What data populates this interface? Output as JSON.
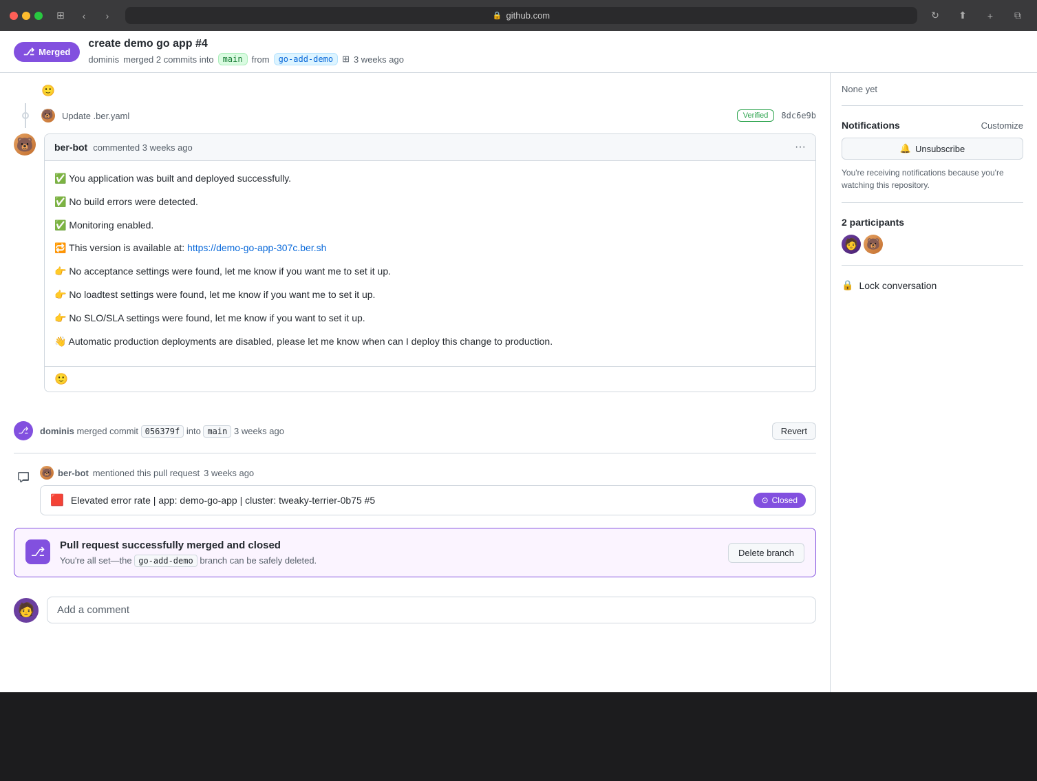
{
  "browser": {
    "url": "github.com",
    "lock": "🔒"
  },
  "header": {
    "merged_badge": "Merged",
    "merged_icon": "⎇",
    "pr_title": "create demo go app #4",
    "pr_meta_user": "dominis",
    "pr_meta_action": "merged 2 commits into",
    "pr_meta_branch_target": "main",
    "pr_meta_from": "from",
    "pr_meta_branch_source": "go-add-demo",
    "pr_meta_time": "3 weeks ago"
  },
  "commit": {
    "text": "Update .ber.yaml",
    "verified": "Verified",
    "hash": "8dc6e9b"
  },
  "comment": {
    "author": "ber-bot",
    "action": "commented",
    "time": "3 weeks ago",
    "body_lines": [
      "✅ You application was built and deployed successfully.",
      "✅ No build errors were detected.",
      "✅ Monitoring enabled."
    ],
    "link_prefix": "🔁 This version is available at: ",
    "link_text": "https://demo-go-app-307c.ber.sh",
    "link_url": "https://demo-go-app-307c.ber.sh",
    "notice_lines": [
      "👉 No acceptance settings were found, let me know if you want me to set it up.",
      "👉 No loadtest settings were found, let me know if you want me to set it up.",
      "👉 No SLO/SLA settings were found, let me know if you want to set it up."
    ],
    "footer_line": "👋 Automatic production deployments are disabled, please let me know when can I deploy this change to production."
  },
  "merge_event": {
    "user": "dominis",
    "action": "merged commit",
    "commit_hash": "056379f",
    "into": "into",
    "branch": "main",
    "time": "3 weeks ago",
    "revert_btn": "Revert"
  },
  "mention": {
    "bot": "ber-bot",
    "action": "mentioned this pull request",
    "time": "3 weeks ago",
    "issue_icon": "🔴",
    "issue_title": "Elevated error rate | app: demo-go-app | cluster: tweaky-terrier-0b75 #5",
    "closed_label": "Closed",
    "closed_icon": "⊙"
  },
  "merged_box": {
    "title": "Pull request successfully merged and closed",
    "desc_prefix": "You're all set—the ",
    "branch_name": "go-add-demo",
    "desc_suffix": " branch can be safely deleted.",
    "delete_btn": "Delete branch"
  },
  "add_comment": {
    "label": "Add a comment"
  },
  "sidebar": {
    "none_yet": "None yet",
    "notifications_title": "Notifications",
    "customize_link": "Customize",
    "unsubscribe_btn": "🔔 Unsubscribe",
    "notification_desc": "You're receiving notifications because you're watching this repository.",
    "participants_title": "2 participants",
    "lock_label": "Lock conversation"
  }
}
